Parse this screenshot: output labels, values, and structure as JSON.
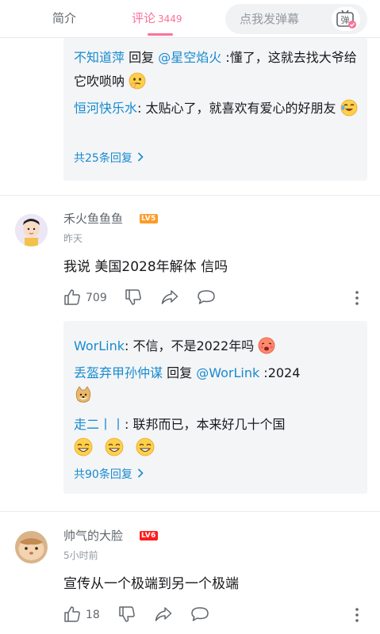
{
  "tabs": {
    "intro_label": "简介",
    "comments_label": "评论",
    "comments_count": "3449"
  },
  "danmaku": {
    "placeholder": "点我发弹幕",
    "button_icon": "danmaku-toggle-icon",
    "button_glyph": "弹"
  },
  "reply_block_1": {
    "replies": [
      {
        "user": "不知道萍",
        "verb": " 回复 ",
        "mention": "@星空焰火",
        "text": " :懂了，这就去找大爷给它吹唢呐",
        "emoji": "thinking-emoji"
      },
      {
        "user": "恒河快乐水",
        "text": ": 太贴心了，就喜欢有爱心的好朋友",
        "emoji": "laughing-tears-emoji"
      }
    ],
    "more_label": "共25条回复"
  },
  "comment_1": {
    "username": "禾火鱼鱼鱼",
    "level": "LV5",
    "time": "昨天",
    "text": "我说 美国2028年解体 信吗",
    "likes": "709"
  },
  "reply_block_2": {
    "replies": [
      {
        "user": "WorLink",
        "text": ": 不信，不是2022年吗",
        "emoji": "blushing-emoji"
      },
      {
        "user": "丢盔弃甲孙仲谋",
        "verb": " 回复 ",
        "mention": "@WorLink",
        "text": " :2024",
        "emoji": "doge-emoji"
      },
      {
        "user": "走二丨丨",
        "text": ": 联邦而已，本来好几十个国",
        "emoji": "smiling-emoji"
      }
    ],
    "more_label": "共90条回复"
  },
  "comment_2": {
    "username": "帅气的大脸",
    "level": "LV6",
    "time": "5小时前",
    "text": "宣传从一个极端到另一个极端",
    "likes": "18"
  },
  "colors": {
    "accent": "#fb7299",
    "link": "#178bcf",
    "lv5": "#ff9b28",
    "lv6": "#ff1c1c",
    "reply_bg": "#f4f5f7"
  }
}
